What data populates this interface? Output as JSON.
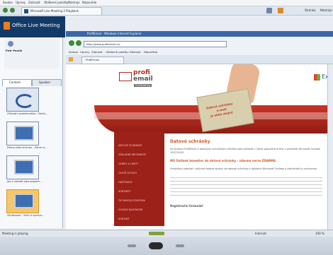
{
  "browser": {
    "menu": [
      "Soubor",
      "Úpravy",
      "Zobrazit",
      "Oblíbené položky",
      "Nástroje",
      "Nápověda"
    ],
    "tab_title": "Microsoft Live Meeting 2 Playback",
    "right_tools": [
      "Stránka",
      "Nástroje"
    ]
  },
  "live_meeting": {
    "brand": "Office Live Meeting",
    "presenter_name": "Petr Pavlík",
    "tabs": [
      "Content",
      "Speaker"
    ],
    "slides": [
      {
        "caption": "Základní problematika / Šablo..."
      },
      {
        "caption": "Demo-slide stránka - Zatím si..."
      },
      {
        "caption": "Jak-e zařadit jako poplach..."
      },
      {
        "caption": "Zkušenosti - Setri si správe..."
      }
    ]
  },
  "inner_browser": {
    "title": "ProfiEmail - Windows Internet Explorer",
    "address": "http://www.profiemail.cz/",
    "menu": [
      "Soubor",
      "Úpravy",
      "Zobrazit",
      "Oblíbené položky",
      "Nástroje",
      "Nápověda"
    ],
    "tab_title": "ProfiEmail"
  },
  "website": {
    "logo_top": "profi",
    "logo_bottom": "email",
    "logo_sub": "ProfiHosting",
    "card_line1": "Datové schránky",
    "card_line2": "e-mail",
    "card_line3": "je stále stejný",
    "partner": "Exc",
    "nav_items": [
      "DATOVÉ SCHRÁNKY",
      "ZÁKLADNÍ INFORMACE",
      "CENÍKY A LIMITY",
      "ČASTÉ DOTAZY",
      "FAKTURACE",
      "KONTAKTY",
      "TECHNICKÁ PODPORA",
      "ÚVODNÍ NASTAVENÍ",
      "KONTAKT"
    ],
    "heading": "Datové schránky",
    "para1": "Se službou ProfiEmail a datovými schránkami můžete komunikovat s úřady pohodlně přímo v prostředí Microsoft Outlook 2007/2003.",
    "subheading": "MS Outlook konektor do datové schránky - zdarma verze ZDARMA",
    "para2": "Umožňuje odesílat i přijímat datové zprávy do datové schránky z aplikace Microsoft Outlook a přehledně je archivovat.",
    "link": "Registrační formulář"
  },
  "status": {
    "left": "Meeting is playing",
    "middle": "Internet",
    "zoom": "100 %"
  },
  "colors": {
    "lm_blue": "#123a66",
    "brand_red": "#b52a1f",
    "nav_red": "#9c2119",
    "heading_orange": "#d2571f"
  }
}
